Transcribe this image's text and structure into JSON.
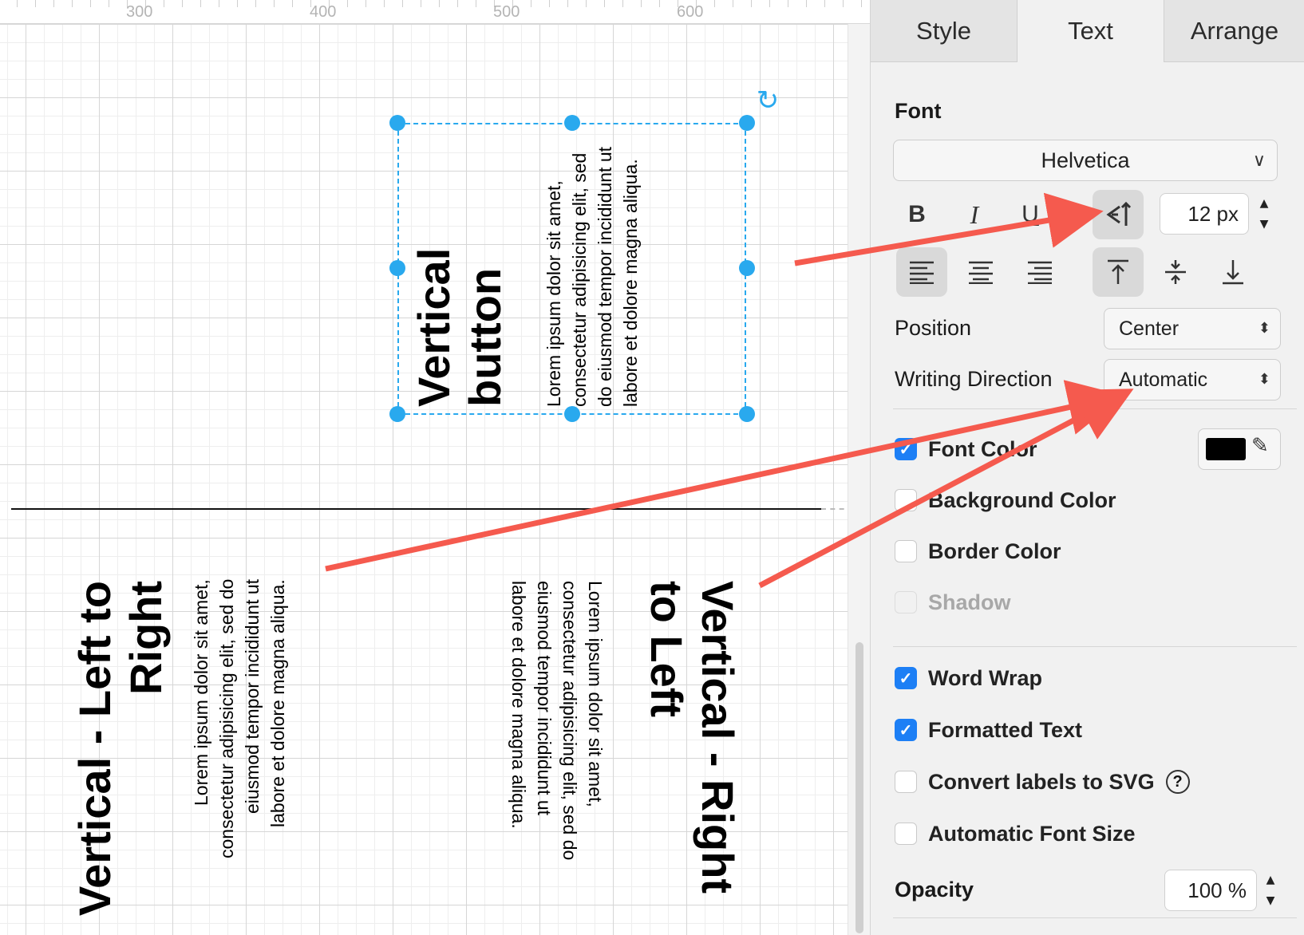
{
  "ruler": {
    "ticks": [
      "300",
      "400",
      "500",
      "600"
    ]
  },
  "canvas": {
    "selected_shape": {
      "title": "Vertical button",
      "body": "Lorem ipsum dolor sit amet, consectetur adipisicing elit, sed do eiusmod tempor incididunt ut labore et dolore magna aliqua."
    },
    "left_to_right": {
      "title_lines": [
        "Vertical - Left to",
        "Right"
      ],
      "body_lines": [
        "Lorem ipsum dolor sit amet,",
        "consectetur adipisicing elit, sed do",
        "eiusmod tempor incididunt ut",
        "labore et dolore magna aliqua."
      ]
    },
    "right_to_left": {
      "title_lines": [
        "Vertical - Right",
        "to Left"
      ],
      "body_lines": [
        "Lorem ipsum dolor sit amet,",
        "consectetur adipisicing elit, sed do",
        "eiusmod tempor incididunt ut",
        "labore et dolore magna aliqua."
      ]
    }
  },
  "panel": {
    "tabs": [
      {
        "label": "Style",
        "active": false
      },
      {
        "label": "Text",
        "active": true
      },
      {
        "label": "Arrange",
        "active": false
      }
    ],
    "font": {
      "section_label": "Font",
      "family": "Helvetica",
      "bold": "B",
      "italic": "I",
      "underline": "U",
      "vertical_text_icon": "vertical-text-icon",
      "size": "12 px"
    },
    "position": {
      "label": "Position",
      "value": "Center"
    },
    "writing_direction": {
      "label": "Writing Direction",
      "value": "Automatic"
    },
    "checkboxes": {
      "font_color": {
        "label": "Font Color",
        "checked": true,
        "color": "#000000"
      },
      "background_color": {
        "label": "Background Color",
        "checked": false
      },
      "border_color": {
        "label": "Border Color",
        "checked": false
      },
      "shadow": {
        "label": "Shadow",
        "checked": false,
        "disabled": true
      },
      "word_wrap": {
        "label": "Word Wrap",
        "checked": true
      },
      "formatted_text": {
        "label": "Formatted Text",
        "checked": true
      },
      "convert_svg": {
        "label": "Convert labels to SVG",
        "checked": false,
        "help": "?"
      },
      "auto_font_size": {
        "label": "Automatic Font Size",
        "checked": false
      }
    },
    "opacity": {
      "label": "Opacity",
      "value": "100 %"
    }
  },
  "colors": {
    "selection": "#29a9ee",
    "annotation_arrow": "#f55a4e",
    "checkbox_checked": "#1d7ff5"
  }
}
